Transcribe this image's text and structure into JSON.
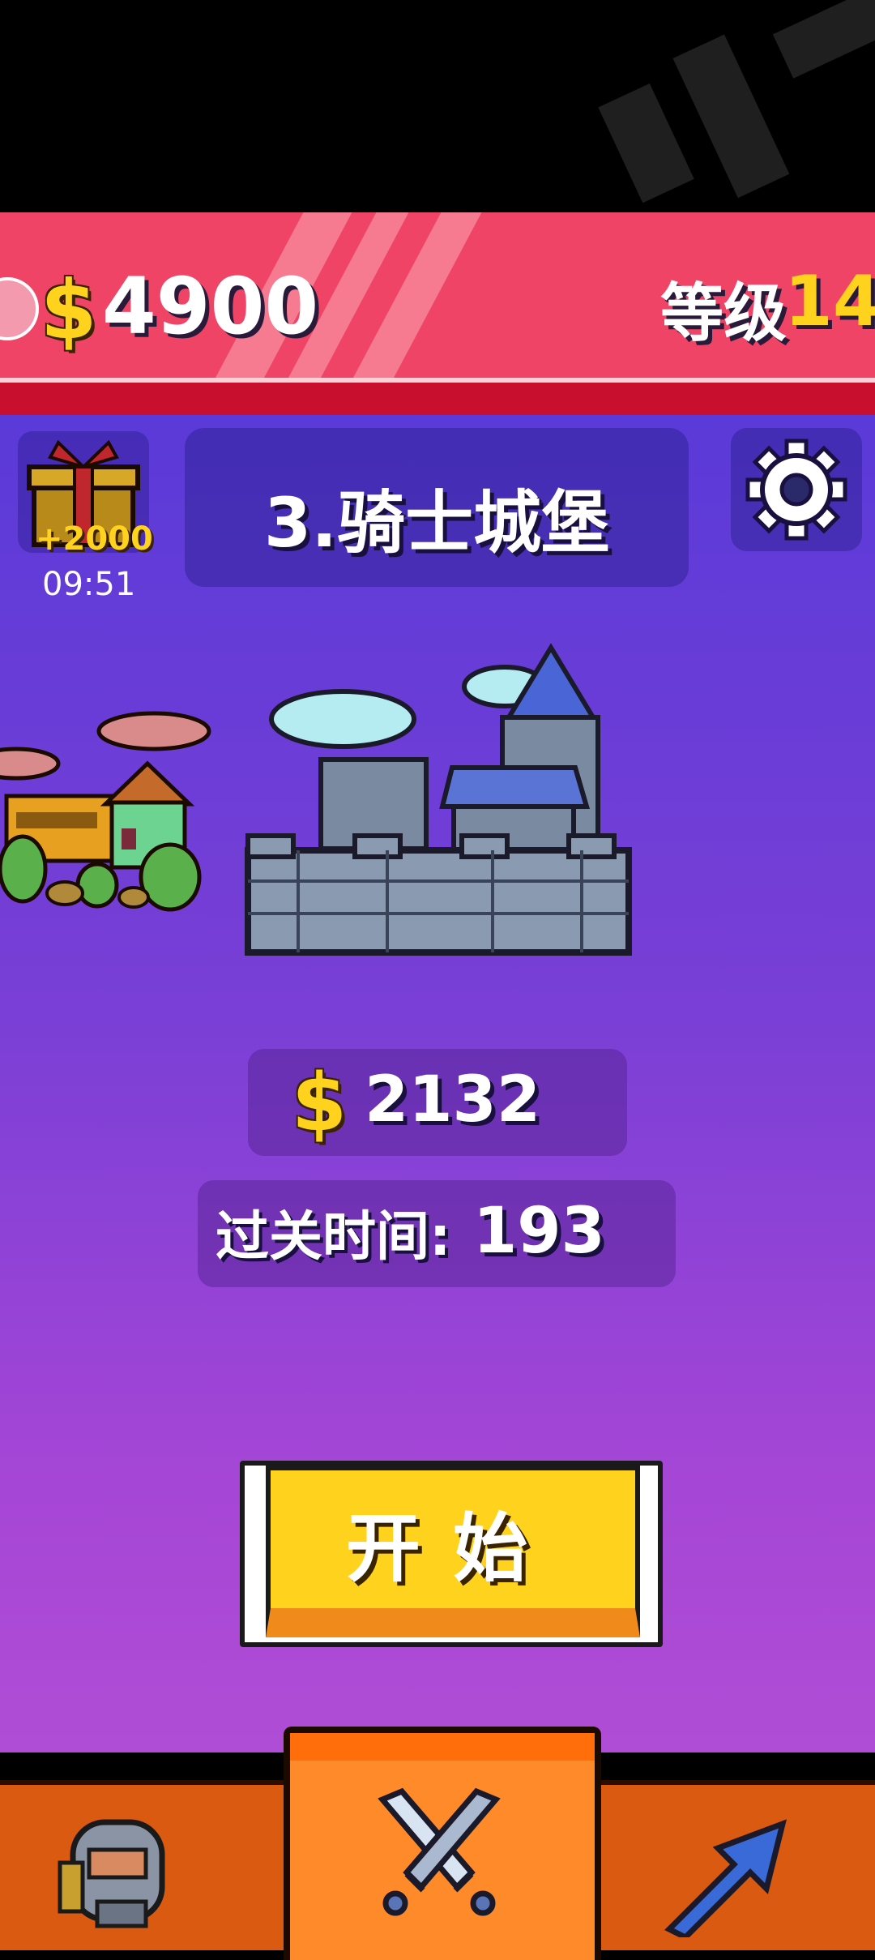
{
  "header": {
    "currency_symbol": "$",
    "money": "4900",
    "level_label": "等级",
    "level_value": "14"
  },
  "gift": {
    "reward": "+2000",
    "timer": "09:51"
  },
  "stage": {
    "name": "3.骑士城堡",
    "reward_symbol": "$",
    "reward": "2132",
    "time_label": "过关时间:",
    "time_value": "193"
  },
  "actions": {
    "start_label": "开始"
  },
  "bottom_nav": {
    "tabs": [
      {
        "icon": "knight-character-icon"
      },
      {
        "icon": "crossed-swords-icon",
        "active": true
      },
      {
        "icon": "arrow-up-right-icon"
      }
    ]
  },
  "colors": {
    "header_red": "#ef4466",
    "gold": "#ffd21e",
    "bg_top": "#5a3ad8",
    "bg_bottom": "#b04dd6",
    "nav_orange": "#d95a10"
  }
}
